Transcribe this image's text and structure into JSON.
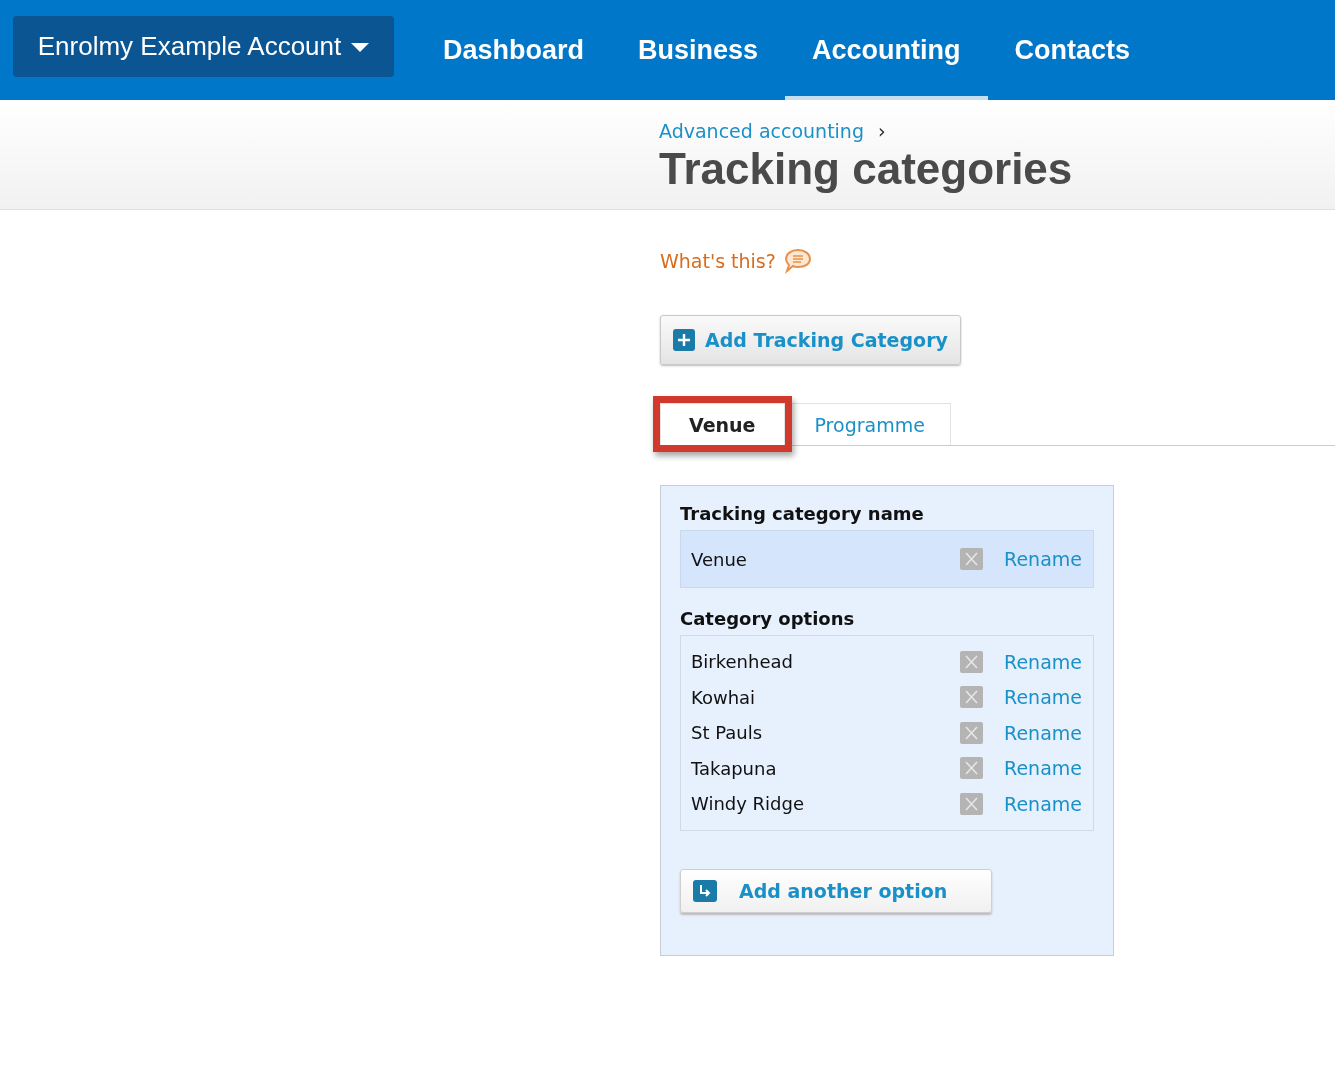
{
  "account_menu": {
    "label": "Enrolmy Example Account"
  },
  "nav": [
    {
      "label": "Dashboard",
      "selected": false
    },
    {
      "label": "Business",
      "selected": false
    },
    {
      "label": "Accounting",
      "selected": true
    },
    {
      "label": "Contacts",
      "selected": false
    }
  ],
  "breadcrumb": {
    "link": "Advanced accounting",
    "separator": "›"
  },
  "page_title": "Tracking categories",
  "help_link": "What's this?",
  "add_category_button": "Add Tracking Category",
  "tabs": [
    {
      "label": "Venue",
      "selected": true,
      "annotated": true
    },
    {
      "label": "Programme",
      "selected": false,
      "annotated": false
    }
  ],
  "panel": {
    "name_heading": "Tracking category name",
    "name_row": {
      "name": "Venue",
      "action": "Rename"
    },
    "options_heading": "Category options",
    "options": [
      {
        "name": "Birkenhead",
        "action": "Rename"
      },
      {
        "name": "Kowhai",
        "action": "Rename"
      },
      {
        "name": "St Pauls",
        "action": "Rename"
      },
      {
        "name": "Takapuna",
        "action": "Rename"
      },
      {
        "name": "Windy Ridge",
        "action": "Rename"
      }
    ],
    "add_option_button": "Add another option"
  }
}
